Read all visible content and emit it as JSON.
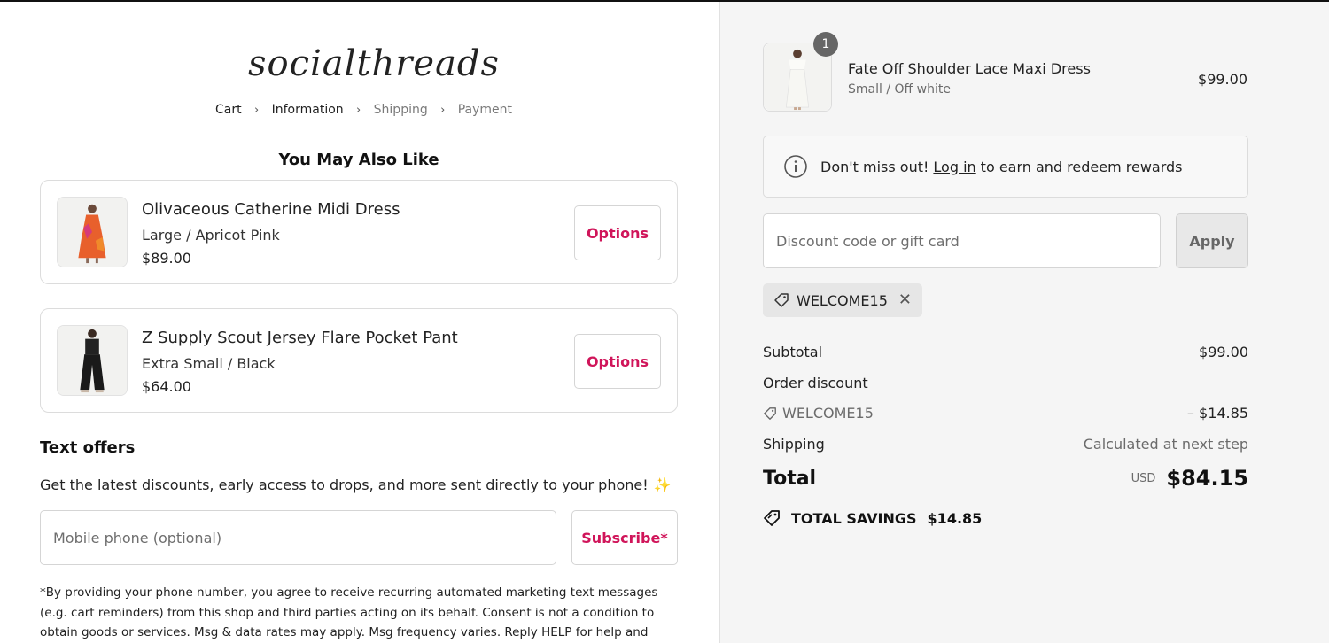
{
  "brand": {
    "logo_text": "socialthreads"
  },
  "breadcrumb": [
    {
      "label": "Cart"
    },
    {
      "label": "Information"
    },
    {
      "label": "Shipping"
    },
    {
      "label": "Payment"
    }
  ],
  "upsell": {
    "title": "You May Also Like",
    "items": [
      {
        "name": "Olivaceous Catherine Midi Dress",
        "variant": "Large / Apricot Pink",
        "price": "$89.00",
        "button": "Options"
      },
      {
        "name": "Z Supply Scout Jersey Flare Pocket Pant",
        "variant": "Extra Small / Black",
        "price": "$64.00",
        "button": "Options"
      }
    ]
  },
  "text_offers": {
    "title": "Text offers",
    "description": "Get the latest discounts, early access to drops, and more sent directly to your phone!",
    "phone_placeholder": "Mobile phone (optional)",
    "subscribe_label": "Subscribe*",
    "disclaimer": "*By providing your phone number, you agree to receive recurring automated marketing text messages (e.g. cart reminders) from this shop and third parties acting on its behalf. Consent is not a condition to obtain goods or services. Msg & data rates may apply. Msg frequency varies. Reply HELP for help and STOP to cancel."
  },
  "cart_item": {
    "quantity": "1",
    "name": "Fate Off Shoulder Lace Maxi Dress",
    "variant": "Small / Off white",
    "price": "$99.00"
  },
  "rewards": {
    "prefix": "Don't miss out!",
    "link": "Log in",
    "suffix": "to earn and redeem rewards"
  },
  "discount": {
    "placeholder": "Discount code or gift card",
    "apply_label": "Apply",
    "applied_code": "WELCOME15"
  },
  "summary": {
    "subtotal_label": "Subtotal",
    "subtotal_value": "$99.00",
    "order_discount_label": "Order discount",
    "code": "WELCOME15",
    "discount_value": "– $14.85",
    "shipping_label": "Shipping",
    "shipping_value": "Calculated at next step",
    "total_label": "Total",
    "currency": "USD",
    "total_value": "$84.15",
    "savings_label": "TOTAL SAVINGS",
    "savings_value": "$14.85"
  },
  "colors": {
    "accent": "#d0155a",
    "sidebar_bg": "#f5f5f5"
  }
}
